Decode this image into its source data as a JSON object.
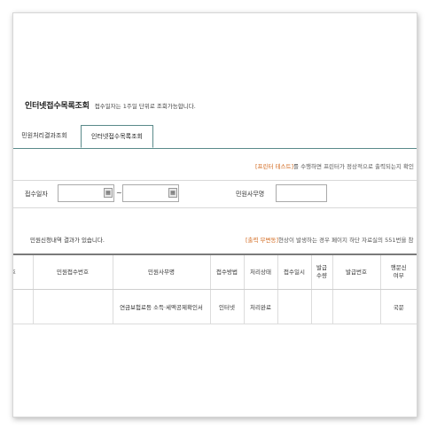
{
  "page": {
    "title": "인터넷접수목록조회",
    "title_note": "접수일자는 1주일 단위로 조회가능합니다."
  },
  "tabs": [
    {
      "label": "민원처리결과조회",
      "active": false
    },
    {
      "label": "인터넷접수목록조회",
      "active": true
    }
  ],
  "notice_top": {
    "tag": "[프린터 테스트]",
    "text": "를 수행하면 프린터가 정상적으로 출력되는지 확인"
  },
  "search": {
    "date_label": "접수일자",
    "date_from": "",
    "date_to": "",
    "range_sep": "~",
    "calendar_icon": "calendar-icon",
    "title_label": "민원사무명",
    "title_value": ""
  },
  "result_msg": "민원신청내역 결과가 있습니다.",
  "notice_bottom": {
    "tag": "[출력 무변동]",
    "text": "현상이 발생하는 경우 페이지 하단 자료실의 551번을 참"
  },
  "table": {
    "headers": [
      "호",
      "민원접수번호",
      "민원사무명",
      "접수방법",
      "처리상태",
      "접수일시",
      "발급\n수량",
      "발급번호",
      "행문신\n여부"
    ],
    "rows": [
      [
        "",
        "",
        "연금보험료등 소득·세액공제확인서",
        "인터넷",
        "처리완료",
        "",
        "",
        "",
        "국문"
      ]
    ]
  },
  "colors": {
    "accent": "#d2691e",
    "tab_border": "#5a8a8a"
  }
}
